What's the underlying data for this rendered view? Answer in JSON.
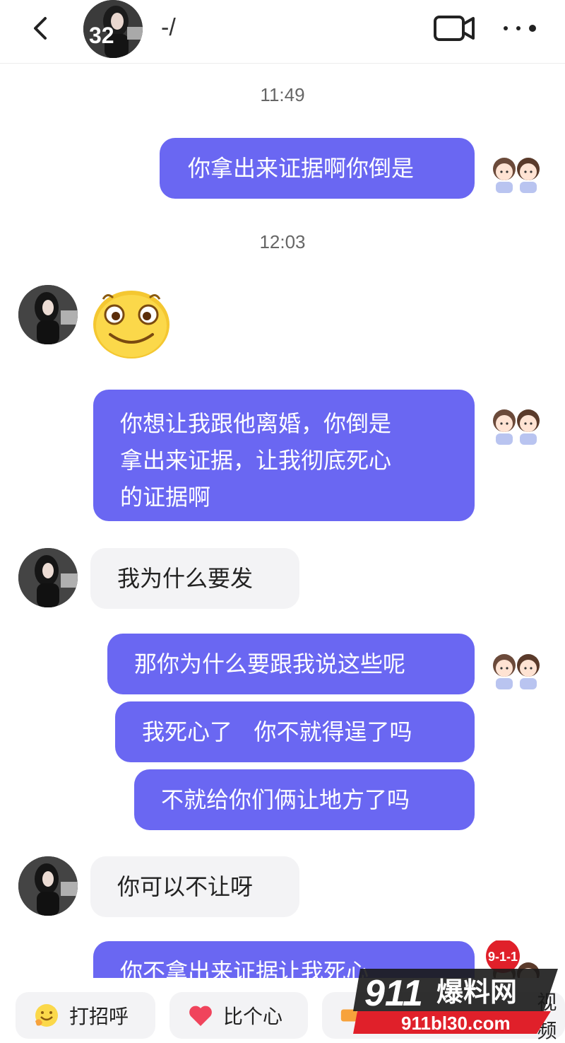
{
  "header": {
    "avatar_badge": "32",
    "contact_name": "-/",
    "back_icon": "chevron-left-icon",
    "video_icon": "video-call-icon",
    "more_icon": "more-dots-icon"
  },
  "messages": {
    "time1": "11:49",
    "m1": "你拿出来证据啊你倒是",
    "time2": "12:03",
    "m2_emoji": "smile-emoji",
    "m3_l1": "你想让我跟他离婚，你倒是",
    "m3_l2": "拿出来证据，让我彻底死心",
    "m3_l3": "的证据啊",
    "m4": "我为什么要发",
    "m5": "那你为什么要跟我说这些呢",
    "m6": "我死心了   你不就得逞了吗",
    "m7": "不就给你们俩让地方了吗",
    "m8": "你可以不让呀",
    "m9": "你不拿出来证据让我死心"
  },
  "bottom_bar": {
    "chip1": "打招呼",
    "chip2": "比个心",
    "chip3_partial": "视频"
  },
  "watermark": {
    "top": "9-1-1",
    "brand_num": "911",
    "brand_text": "爆料网",
    "url": "911bl30.com"
  },
  "colors": {
    "my_bubble": "#6a67f2",
    "their_bubble": "#f3f3f5",
    "watermark_red": "#e0202a"
  }
}
